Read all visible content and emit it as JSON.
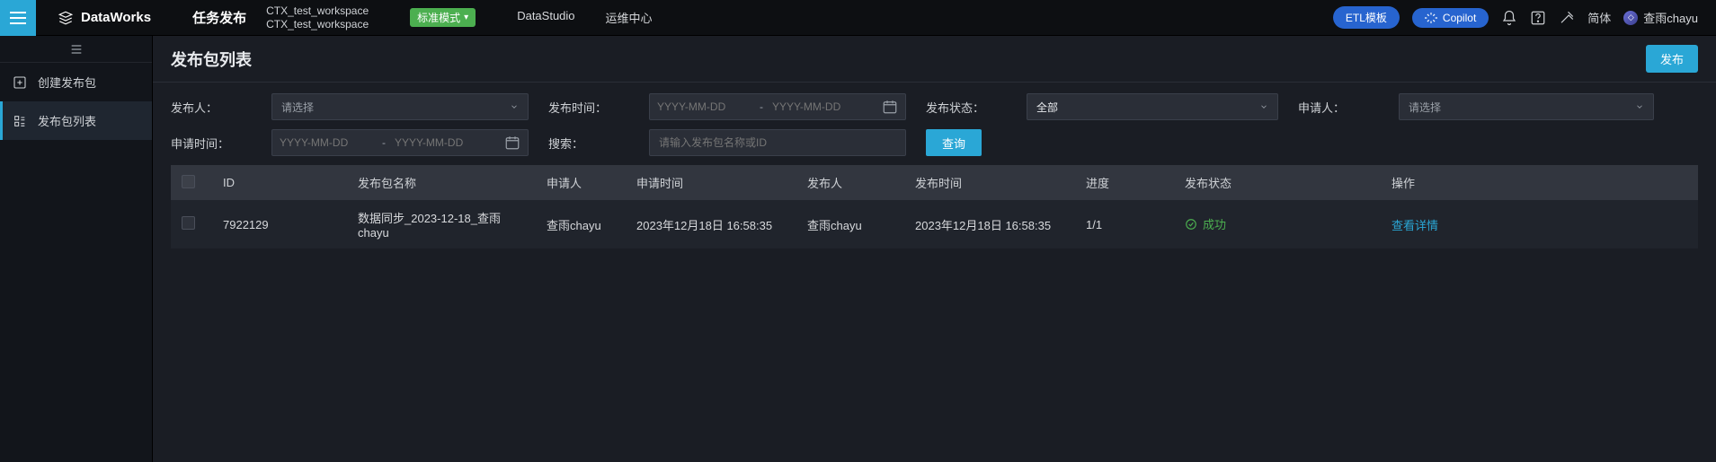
{
  "header": {
    "brand": "DataWorks",
    "app_name": "任务发布",
    "workspace_line1": "CTX_test_workspace",
    "workspace_line2": "CTX_test_workspace",
    "mode_badge": "标准模式",
    "nav": {
      "datastudio": "DataStudio",
      "ops": "运维中心"
    },
    "etl_template": "ETL模板",
    "copilot": "Copilot",
    "lang": "简体",
    "user_name": "查雨chayu"
  },
  "sidebar": {
    "items": [
      {
        "label": "创建发布包"
      },
      {
        "label": "发布包列表"
      }
    ]
  },
  "page": {
    "title": "发布包列表",
    "publish_btn": "发布"
  },
  "filters": {
    "publisher_label": "发布人：",
    "publisher_placeholder": "请选择",
    "publish_time_label": "发布时间：",
    "date_placeholder": "YYYY-MM-DD",
    "publish_status_label": "发布状态：",
    "publish_status_value": "全部",
    "applicant_label": "申请人：",
    "applicant_placeholder": "请选择",
    "apply_time_label": "申请时间：",
    "search_label": "搜索：",
    "search_placeholder": "请输入发布包名称或ID",
    "query_btn": "查询"
  },
  "table": {
    "columns": {
      "id": "ID",
      "name": "发布包名称",
      "applicant": "申请人",
      "apply_time": "申请时间",
      "publisher": "发布人",
      "publish_time": "发布时间",
      "progress": "进度",
      "status": "发布状态",
      "action": "操作"
    },
    "rows": [
      {
        "id": "7922129",
        "name": "数据同步_2023-12-18_查雨chayu",
        "applicant": "查雨chayu",
        "apply_time": "2023年12月18日 16:58:35",
        "publisher": "查雨chayu",
        "publish_time": "2023年12月18日 16:58:35",
        "progress": "1/1",
        "status": "成功",
        "action": "查看详情"
      }
    ]
  }
}
